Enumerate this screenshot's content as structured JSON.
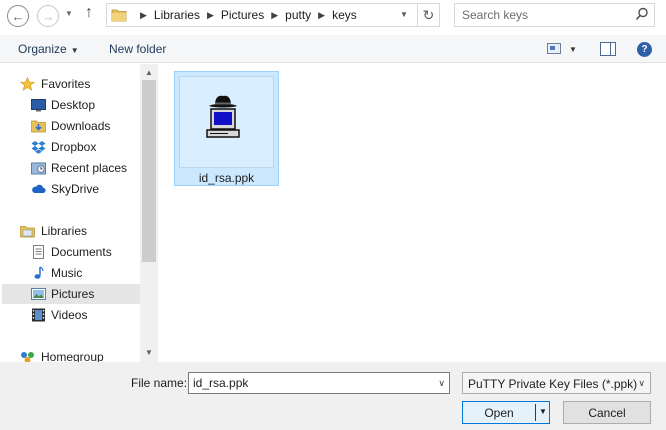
{
  "address_bar": {
    "crumbs": [
      "Libraries",
      "Pictures",
      "putty",
      "keys"
    ]
  },
  "search": {
    "placeholder": "Search keys"
  },
  "commands": {
    "organize_label": "Organize",
    "new_folder_label": "New folder"
  },
  "nav": {
    "favorites": "Favorites",
    "desktop": "Desktop",
    "downloads": "Downloads",
    "dropbox": "Dropbox",
    "recent_places": "Recent places",
    "skydrive": "SkyDrive",
    "libraries": "Libraries",
    "documents": "Documents",
    "music": "Music",
    "pictures": "Pictures",
    "videos": "Videos",
    "homegroup": "Homegroup"
  },
  "files": {
    "item_name": "id_rsa.ppk"
  },
  "bottom": {
    "file_name_label": "File name:",
    "file_name_value": "id_rsa.ppk",
    "file_type": "PuTTY Private Key Files (*.ppk)",
    "open_label": "Open",
    "cancel_label": "Cancel"
  },
  "colors": {
    "selection": "#cce8ff",
    "accent": "#0078d7"
  }
}
